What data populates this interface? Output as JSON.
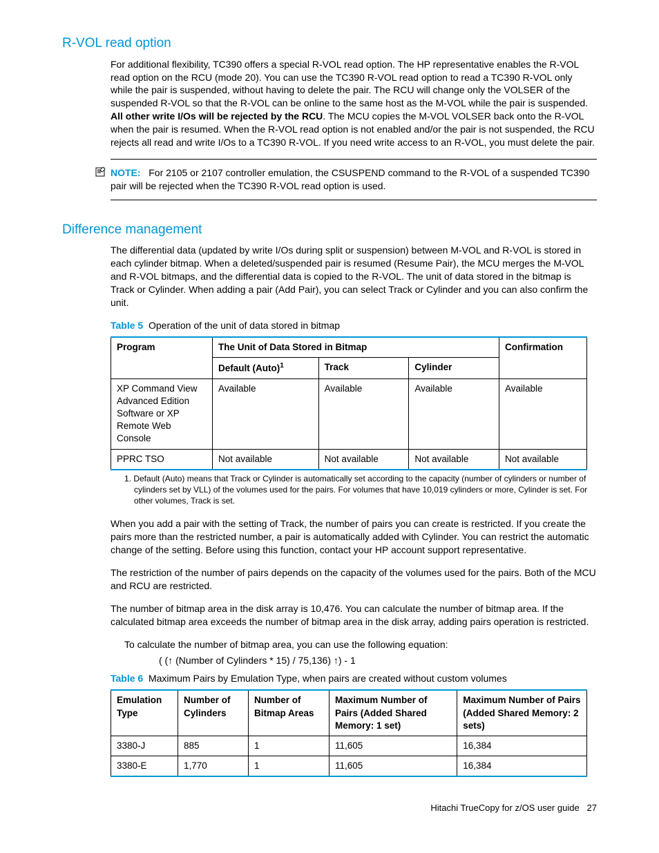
{
  "section1": {
    "heading": "R-VOL read option",
    "para": "For additional flexibility, TC390 offers a special R-VOL read option. The HP representative enables the R-VOL read option on the RCU (mode 20). You can use the TC390 R-VOL read option to read a TC390 R-VOL only while the pair is suspended, without having to delete the pair. The RCU will change only the VOLSER of the suspended R-VOL so that the R-VOL can be online to the same host as the M-VOL while the pair is suspended. ",
    "para_bold": "All other write I/Os will be rejected by the RCU",
    "para_after": ". The MCU copies the M-VOL VOLSER back onto the R-VOL when the pair is resumed. When the R-VOL read option is not enabled and/or the pair is not suspended, the RCU rejects all read and write I/Os to a TC390 R-VOL. If you need write access to an R-VOL, you must delete the pair.",
    "note_label": "NOTE:",
    "note_text": "For 2105 or 2107 controller emulation, the CSUSPEND command to the R-VOL of a suspended TC390 pair will be rejected when the TC390 R-VOL read option is used."
  },
  "section2": {
    "heading": "Difference management",
    "para1": "The differential data (updated by write I/Os during split or suspension) between M-VOL and R-VOL is stored in each cylinder bitmap. When a deleted/suspended pair is resumed (Resume Pair), the MCU merges the M-VOL and R-VOL bitmaps, and the differential data is copied to the R-VOL. The unit of data stored in the bitmap is Track or Cylinder. When adding a pair (Add Pair), you can select Track or Cylinder and you can also confirm the unit.",
    "table5": {
      "caption_label": "Table 5",
      "caption_text": "Operation of the unit of data stored in bitmap",
      "h_program": "Program",
      "h_unit": "The Unit of Data Stored in Bitmap",
      "h_conf": "Confirmation",
      "h_default": "Default (Auto)",
      "h_default_sup": "1",
      "h_track": "Track",
      "h_cyl": "Cylinder",
      "rows": [
        {
          "program": "XP Command View Advanced Edition Software or XP Remote Web Console",
          "default": "Available",
          "track": "Available",
          "cyl": "Available",
          "conf": "Available"
        },
        {
          "program": "PPRC TSO",
          "default": "Not available",
          "track": "Not available",
          "cyl": "Not available",
          "conf": "Not available"
        }
      ],
      "footnote": "1.  Default (Auto) means that Track or Cylinder is automatically set according to the capacity (number of cylinders or number of cylinders set by VLL) of the volumes used for the pairs. For volumes that have 10,019 cylinders or more, Cylinder is set. For other volumes, Track is set."
    },
    "para2": "When you add a pair with the setting of Track, the number of pairs you can create is restricted. If you create the pairs more than the restricted number, a pair is automatically added with Cylinder. You can restrict the automatic change of the setting. Before using this function, contact your HP account support representative.",
    "para3": "The restriction of the number of pairs depends on the capacity of the volumes used for the pairs. Both of the MCU and RCU are restricted.",
    "para4": "The number of bitmap area in the disk array is 10,476. You can calculate the number of bitmap area. If the calculated bitmap area exceeds the number of bitmap area in the disk array, adding pairs operation is restricted.",
    "eq_intro": "To calculate the number of bitmap area, you can use the following equation:",
    "eq": "( (↑ (Number of Cylinders * 15) / 75,136) ↑) - 1",
    "table6": {
      "caption_label": "Table 6",
      "caption_text": "Maximum Pairs by Emulation Type, when pairs are created without custom volumes",
      "h_emu": "Emulation Type",
      "h_ncyl": "Number of Cylinders",
      "h_nbit": "Number of Bitmap Areas",
      "h_max1": "Maximum Number of Pairs (Added Shared Memory: 1 set)",
      "h_max2": "Maximum Number of Pairs (Added Shared Memory: 2 sets)",
      "rows": [
        {
          "emu": "3380-J",
          "ncyl": "885",
          "nbit": "1",
          "max1": "11,605",
          "max2": "16,384"
        },
        {
          "emu": "3380-E",
          "ncyl": "1,770",
          "nbit": "1",
          "max1": "11,605",
          "max2": "16,384"
        }
      ]
    }
  },
  "footer": {
    "title": "Hitachi TrueCopy for z/OS user guide",
    "page": "27"
  }
}
